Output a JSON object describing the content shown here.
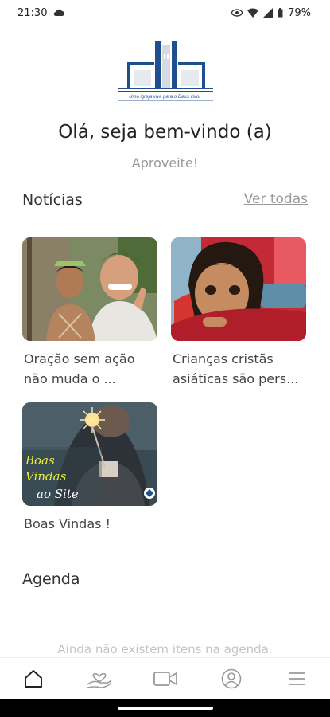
{
  "status_bar": {
    "time": "21:30",
    "battery": "79%"
  },
  "logo": {
    "tagline": "Uma igreja viva para o Deus vivo!"
  },
  "greeting": {
    "title": "Olá, seja bem-vindo (a)",
    "subtitle": "Aproveite!"
  },
  "news": {
    "title": "Notícias",
    "see_all": "Ver todas",
    "items": [
      {
        "caption": "Oração sem ação não muda o ..."
      },
      {
        "caption": "Crianças cristãs asiáticas são pers..."
      },
      {
        "caption": "Boas Vindas !",
        "image_text": "Boas Vindas ao Site"
      }
    ]
  },
  "agenda": {
    "title": "Agenda",
    "empty_message": "Ainda não existem itens na agenda."
  },
  "bottom_nav": {
    "items": [
      "home-icon",
      "donation-hand-icon",
      "video-camera-icon",
      "profile-icon",
      "menu-icon"
    ]
  },
  "colors": {
    "brand_blue": "#1f4f8f",
    "text": "#333333",
    "muted": "#9a9a9a"
  }
}
